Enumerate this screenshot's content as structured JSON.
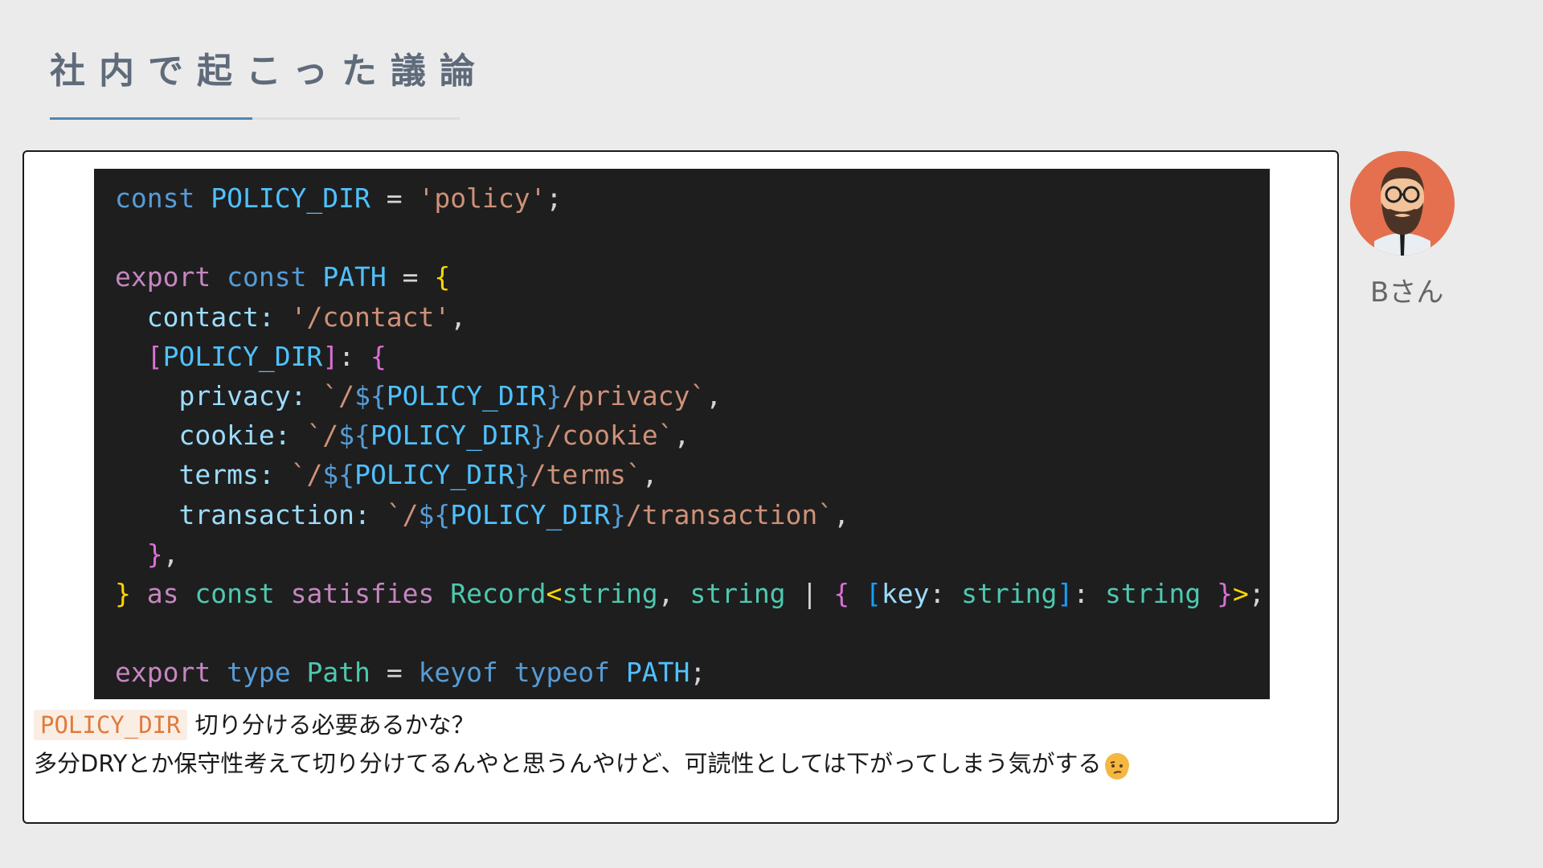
{
  "slide": {
    "title": "社内で起こった議論"
  },
  "code": {
    "line1": {
      "a": "const",
      "b": "POLICY_DIR",
      "c": "=",
      "d": "'policy'",
      "e": ";"
    },
    "line3": {
      "a": "export",
      "b": "const",
      "c": "PATH",
      "d": "=",
      "e": "{"
    },
    "line4": {
      "a": "contact:",
      "b": "'/contact'",
      "c": ","
    },
    "line5": {
      "a": "[",
      "b": "POLICY_DIR",
      "c": "]",
      "d": ":",
      "e": "{"
    },
    "line6": {
      "a": "privacy:",
      "b": "`/",
      "c": "${",
      "d": "POLICY_DIR",
      "e": "}",
      "f": "/privacy`",
      "g": ","
    },
    "line7": {
      "a": "cookie:",
      "b": "`/",
      "c": "${",
      "d": "POLICY_DIR",
      "e": "}",
      "f": "/cookie`",
      "g": ","
    },
    "line8": {
      "a": "terms:",
      "b": "`/",
      "c": "${",
      "d": "POLICY_DIR",
      "e": "}",
      "f": "/terms`",
      "g": ","
    },
    "line9": {
      "a": "transaction:",
      "b": "`/",
      "c": "${",
      "d": "POLICY_DIR",
      "e": "}",
      "f": "/transaction`",
      "g": ","
    },
    "line10": {
      "a": "}",
      "b": ","
    },
    "line11": {
      "a": "}",
      "b": "as",
      "c": "const",
      "d": "satisfies",
      "e": "Record",
      "f": "<",
      "g": "string",
      "h": ",",
      "i": "string",
      "j": "|",
      "k": "{",
      "l": "[",
      "m": "key",
      "n": ":",
      "o": "string",
      "p": "]",
      "q": ":",
      "r": "string",
      "s": "}",
      "t": ">",
      "u": ";"
    },
    "line13": {
      "a": "export",
      "b": "type",
      "c": "Path",
      "d": "=",
      "e": "keyof",
      "f": "typeof",
      "g": "PATH",
      "h": ";"
    }
  },
  "discussion": {
    "inline_code": "POLICY_DIR",
    "line1_text": "切り分ける必要あるかな？",
    "line2_text": "多分DRYとか保守性考えて切り分けてるんやと思うんやけど、可読性としては下がってしまう気がする"
  },
  "speaker": {
    "name": "Bさん"
  },
  "colors": {
    "background": "#ebebeb",
    "title": "#5f6b7a",
    "rule_accent": "#4f86b3",
    "code_bg": "#1e1e1e",
    "avatar_bg": "#e4704f"
  }
}
